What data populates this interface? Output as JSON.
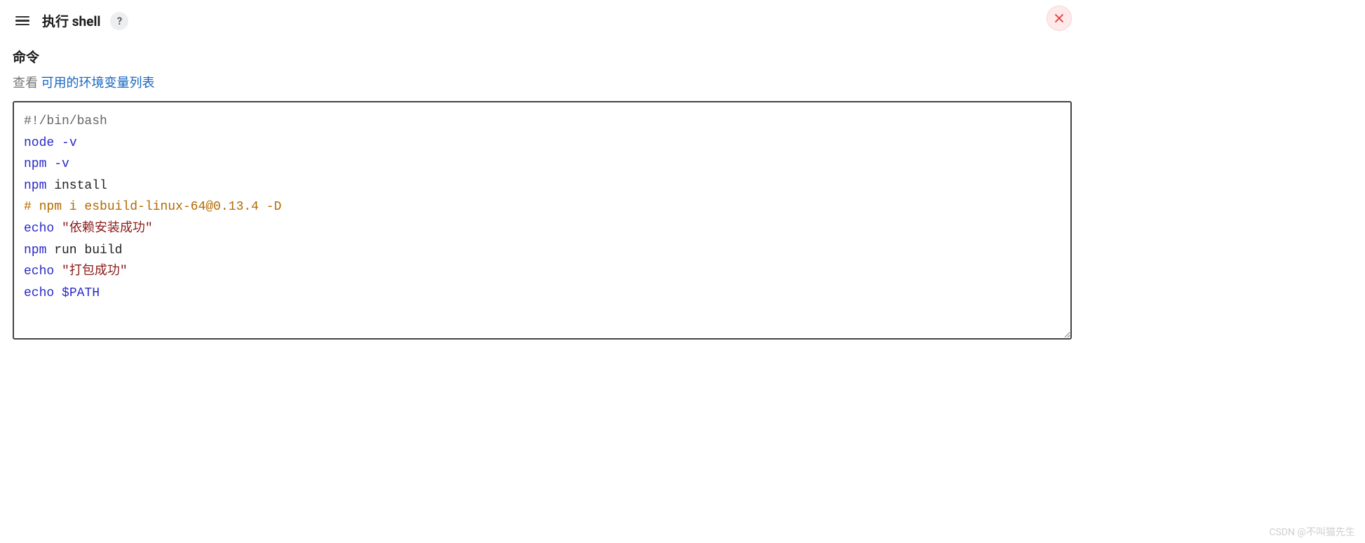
{
  "header": {
    "title": "执行 shell",
    "help_symbol": "?"
  },
  "field": {
    "label": "命令",
    "hint_prefix": "查看 ",
    "hint_link": "可用的环境变量列表"
  },
  "script": {
    "lines": [
      {
        "type": "shebang",
        "text": "#!/bin/bash"
      },
      {
        "type": "cmd_flag",
        "cmd": "node",
        "rest": " -v"
      },
      {
        "type": "cmd_flag",
        "cmd": "npm",
        "rest": " -v"
      },
      {
        "type": "cmd_plain",
        "cmd": "npm",
        "rest": " install"
      },
      {
        "type": "comment",
        "text": "# npm i esbuild-linux-64@0.13.4 -D"
      },
      {
        "type": "cmd_string",
        "cmd": "echo",
        "str": " \"依赖安装成功\""
      },
      {
        "type": "cmd_plain",
        "cmd": "npm",
        "rest": " run build"
      },
      {
        "type": "cmd_string",
        "cmd": "echo",
        "str": " \"打包成功\""
      },
      {
        "type": "cmd_var",
        "cmd": "echo",
        "var": " $PATH"
      }
    ]
  },
  "watermark": "CSDN @不叫猫先生"
}
